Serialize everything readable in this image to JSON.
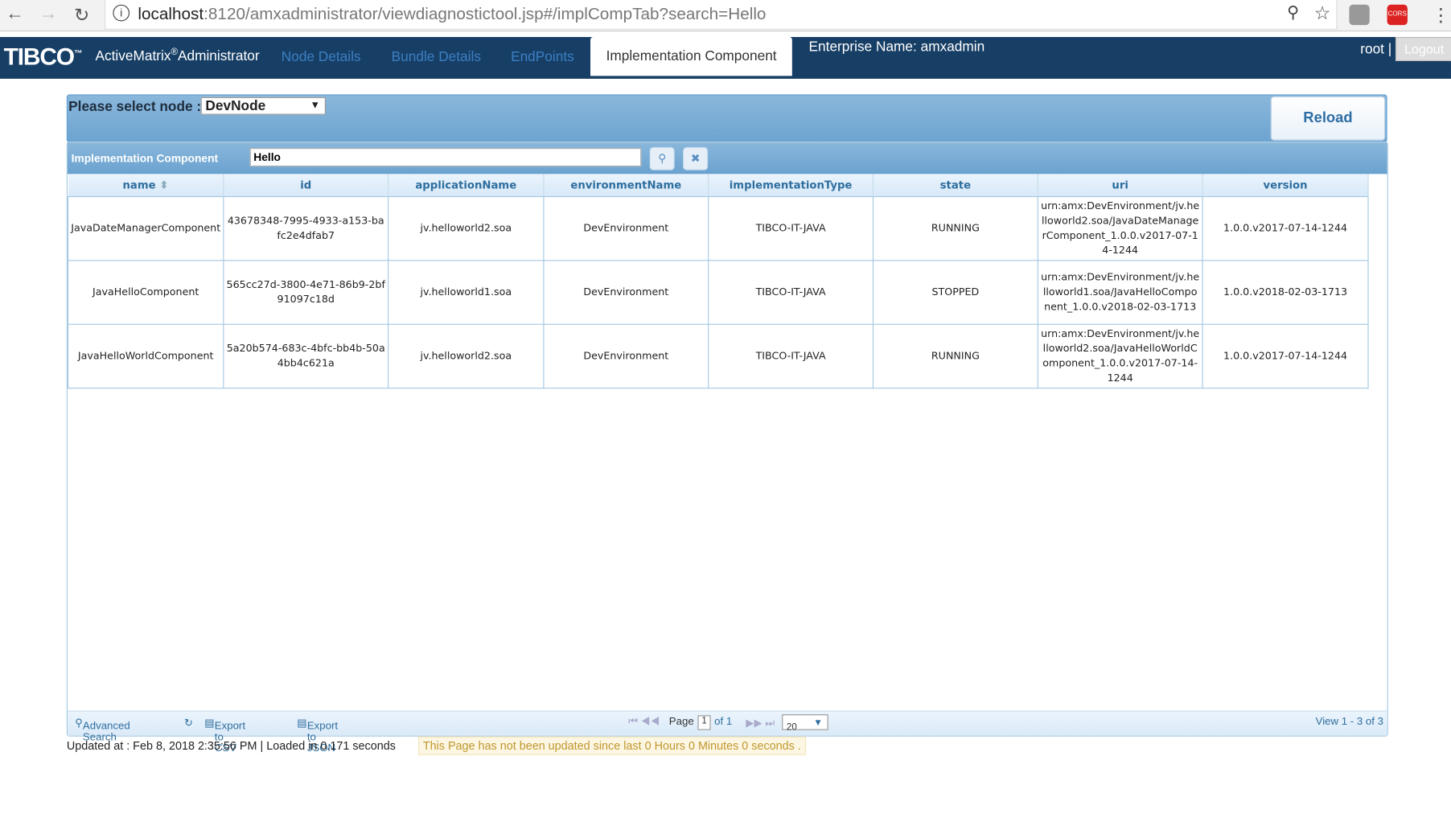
{
  "browser": {
    "url_host": "localhost",
    "url_rest": ":8120/amxadministrator/viewdiagnostictool.jsp#/implCompTab?search=Hello",
    "ext_label": "CORS"
  },
  "header": {
    "logo": "TIBCO",
    "tm": "™",
    "product": "ActiveMatrix",
    "reg": "®",
    "product2": "Administrator",
    "tabs": [
      "Node Details",
      "Bundle Details",
      "EndPoints",
      "Implementation Component"
    ],
    "enterprise": "Enterprise Name: amxadmin",
    "user": "root |",
    "logout": "Logout"
  },
  "node": {
    "label": "Please select node :",
    "value": "DevNode",
    "reload": "Reload"
  },
  "grid": {
    "title": "Implementation Component",
    "search_value": "Hello",
    "columns": [
      "name",
      "id",
      "applicationName",
      "environmentName",
      "implementationType",
      "state",
      "uri",
      "version"
    ],
    "rows": [
      [
        "JavaDateManagerComponent",
        "43678348-7995-4933-a153-bafc2e4dfab7",
        "jv.helloworld2.soa",
        "DevEnvironment",
        "TIBCO-IT-JAVA",
        "RUNNING",
        "urn:amx:DevEnvironment/jv.helloworld2.soa/JavaDateManagerComponent_1.0.0.v2017-07-14-1244",
        "1.0.0.v2017-07-14-1244"
      ],
      [
        "JavaHelloComponent",
        "565cc27d-3800-4e71-86b9-2bf91097c18d",
        "jv.helloworld1.soa",
        "DevEnvironment",
        "TIBCO-IT-JAVA",
        "STOPPED",
        "urn:amx:DevEnvironment/jv.helloworld1.soa/JavaHelloComponent_1.0.0.v2018-02-03-1713",
        "1.0.0.v2018-02-03-1713"
      ],
      [
        "JavaHelloWorldComponent",
        "5a20b574-683c-4bfc-bb4b-50a4bb4c621a",
        "jv.helloworld2.soa",
        "DevEnvironment",
        "TIBCO-IT-JAVA",
        "RUNNING",
        "urn:amx:DevEnvironment/jv.helloworld2.soa/JavaHelloWorldComponent_1.0.0.v2017-07-14-1244",
        "1.0.0.v2017-07-14-1244"
      ]
    ]
  },
  "pager": {
    "advanced": "Advanced Search",
    "csv": "Export to CSV",
    "json": "Export to JSON",
    "page_label": "Page",
    "page": "1",
    "of": "of 1",
    "rows": "20",
    "view": "View 1 - 3 of 3"
  },
  "status": {
    "updated": "Updated at : Feb 8, 2018 2:35:56 PM | Loaded in 0.171 seconds",
    "warning": "This Page has not been updated since last 0 Hours 0 Minutes 0 seconds ."
  }
}
